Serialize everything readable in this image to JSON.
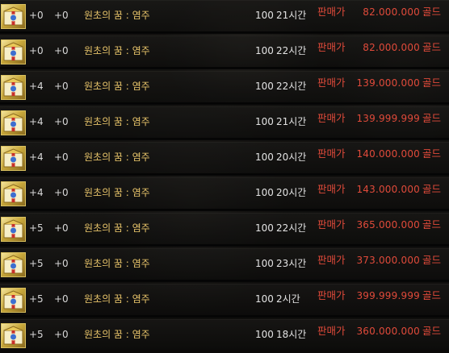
{
  "colors": {
    "name_text": "#e8c46a",
    "price_text": "#e04a3a",
    "value_text": "#e2e2e2",
    "icon_border": "#d8c060"
  },
  "rows": [
    {
      "icon": "item-box-icon",
      "plus1": "+0",
      "plus2": "+0",
      "name": "원초의 꿈 : 염주",
      "qty": "100",
      "time": "21시간",
      "seller": "판매가",
      "price": "82.000.000",
      "unit": "골드"
    },
    {
      "icon": "item-box-icon",
      "plus1": "+0",
      "plus2": "+0",
      "name": "원초의 꿈 : 염주",
      "qty": "100",
      "time": "22시간",
      "seller": "판매가",
      "price": "82.000.000",
      "unit": "골드"
    },
    {
      "icon": "item-box-icon",
      "plus1": "+4",
      "plus2": "+0",
      "name": "원초의 꿈 : 염주",
      "qty": "100",
      "time": "22시간",
      "seller": "판매가",
      "price": "139.000.000",
      "unit": "골드"
    },
    {
      "icon": "item-box-icon",
      "plus1": "+4",
      "plus2": "+0",
      "name": "원초의 꿈 : 염주",
      "qty": "100",
      "time": "21시간",
      "seller": "판매가",
      "price": "139.999.999",
      "unit": "골드"
    },
    {
      "icon": "item-box-icon",
      "plus1": "+4",
      "plus2": "+0",
      "name": "원초의 꿈 : 염주",
      "qty": "100",
      "time": "20시간",
      "seller": "판매가",
      "price": "140.000.000",
      "unit": "골드"
    },
    {
      "icon": "item-box-icon",
      "plus1": "+4",
      "plus2": "+0",
      "name": "원초의 꿈 : 염주",
      "qty": "100",
      "time": "20시간",
      "seller": "판매가",
      "price": "143.000.000",
      "unit": "골드"
    },
    {
      "icon": "item-box-icon",
      "plus1": "+5",
      "plus2": "+0",
      "name": "원초의 꿈 : 염주",
      "qty": "100",
      "time": "22시간",
      "seller": "판매가",
      "price": "365.000.000",
      "unit": "골드"
    },
    {
      "icon": "item-box-icon",
      "plus1": "+5",
      "plus2": "+0",
      "name": "원초의 꿈 : 염주",
      "qty": "100",
      "time": "23시간",
      "seller": "판매가",
      "price": "373.000.000",
      "unit": "골드"
    },
    {
      "icon": "item-box-icon",
      "plus1": "+5",
      "plus2": "+0",
      "name": "원초의 꿈 : 염주",
      "qty": "100",
      "time": "2시간",
      "seller": "판매가",
      "price": "399.999.999",
      "unit": "골드"
    },
    {
      "icon": "item-box-icon",
      "plus1": "+5",
      "plus2": "+0",
      "name": "원초의 꿈 : 염주",
      "qty": "100",
      "time": "18시간",
      "seller": "판매가",
      "price": "360.000.000",
      "unit": "골드"
    }
  ]
}
